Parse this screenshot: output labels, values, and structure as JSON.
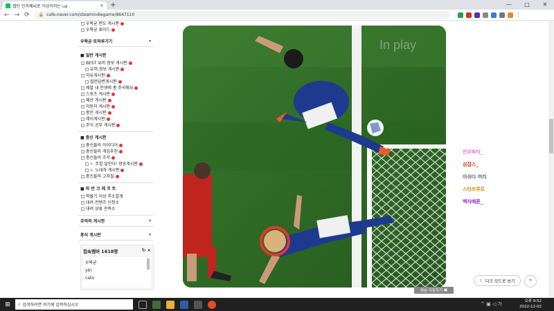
{
  "browser": {
    "tab_title": "캡틴 인카예씨로 이상이하는 ua",
    "tab_close": "×",
    "new_tab": "+",
    "url": "cafe.naver.com/steamindiegame/8647110",
    "window_controls": [
      "—",
      "□",
      "✕"
    ],
    "back": "←",
    "forward": "→",
    "reload": "⟳"
  },
  "sidebar": {
    "top_items": [
      {
        "label": "우왁굳 편도 게시판"
      },
      {
        "label": "우왁굳 표이드"
      }
    ],
    "section_recall": {
      "title": "우왁굳 또하루기기",
      "chevron": "▾"
    },
    "section_general": {
      "title": "■ 일반 게시판",
      "items": [
        {
          "label": "BEST 유머 정보 게시판",
          "sub": false
        },
        {
          "label": "유머,정보 게시판",
          "sub": true
        },
        {
          "label": "자유게시판",
          "sub": false
        },
        {
          "label": "질문답변게시판",
          "sub": true
        },
        {
          "label": "제발 내 인생에 좀 추석해요",
          "sub": false
        },
        {
          "label": "스포츠 게시판",
          "sub": false
        },
        {
          "label": "패션 게시판",
          "sub": false
        },
        {
          "label": "자동차 게시판",
          "sub": false
        },
        {
          "label": "종민 게시판",
          "sub": false
        },
        {
          "label": "레이게시판",
          "sub": false
        },
        {
          "label": "주식 공부 게시판",
          "sub": false
        }
      ]
    },
    "section_fans": {
      "title": "■ 충신 게시판",
      "items": [
        {
          "label": "충신들의 아이디어",
          "sub": false
        },
        {
          "label": "충신들의 게임추천",
          "sub": false
        },
        {
          "label": "충신들의 조각",
          "sub": false
        },
        {
          "label": "ㄴ 조합 달인다! 장송게시판",
          "sub": true
        },
        {
          "label": "ㄴ 노대자 게시판",
          "sub": true
        },
        {
          "label": "충신들의 고자질",
          "sub": false
        }
      ]
    },
    "section_content": {
      "title": "■ 마 만 크 레 프 트",
      "items": [
        {
          "label": "왁물기 이상 주소끌게"
        },
        {
          "label": "대려 컨텐츠 신청소"
        },
        {
          "label": "대려 상류 관측소"
        }
      ]
    },
    "section_memory": {
      "title": "추억의 게시판",
      "chevron": "▾"
    },
    "section_misc": {
      "title": "휴식 게시판",
      "chevron": "▾"
    },
    "online": {
      "title": "접속멤버 1618명",
      "buttons": "↻ ×",
      "members": [
        "우왁굳",
        "ytn",
        "cato"
      ]
    }
  },
  "player": {
    "watermark": "In play",
    "original_link": "원본 저장하기"
  },
  "chat": [
    {
      "name": "안우파타_",
      "color": "#e06fd8"
    },
    {
      "name": "심잡스_",
      "color": "#d2331d"
    },
    {
      "name": "아쉬다 머리",
      "color": "#666666"
    },
    {
      "name": "스타프루트",
      "color": "#c98a11"
    },
    {
      "name": "백자메론_",
      "color": "#8a2ec0"
    }
  ],
  "floating": {
    "dark_mode": "다크 모드로 보기",
    "to_top": "⌃"
  },
  "taskbar": {
    "start": "⊞",
    "search_placeholder": "검색하려면 여기에 입력하십시오",
    "time": "오후 9:52",
    "date": "2022-12-02",
    "tray": "^ ▣ ◁ 가"
  },
  "colors": {
    "naver_green": "#03c75a",
    "badge_red": "#e23a3a",
    "taskbar": "#202020",
    "pitch": "#2f6b27",
    "highlight_circle": "#e8362a",
    "japan_blue": "#1d3a8f"
  }
}
